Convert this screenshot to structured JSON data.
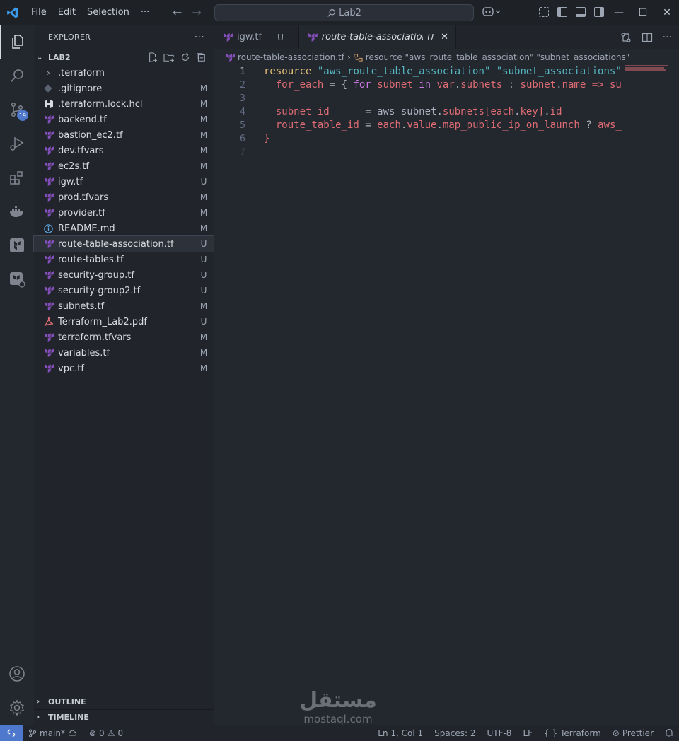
{
  "menu": {
    "items": [
      "File",
      "Edit",
      "Selection",
      "···"
    ]
  },
  "search": {
    "label": "Lab2"
  },
  "window": {
    "minimize": "—",
    "maximize": "☐",
    "close": "✕"
  },
  "activity": {
    "scm_badge": "19"
  },
  "explorer": {
    "title": "EXPLORER",
    "more": "···",
    "root": "LAB2",
    "files": [
      {
        "name": ".terraform",
        "icon": "folder-chevron",
        "status": ""
      },
      {
        "name": ".gitignore",
        "icon": "git-file-icon",
        "status": "M"
      },
      {
        "name": ".terraform.lock.hcl",
        "icon": "hcl-icon",
        "status": "M"
      },
      {
        "name": "backend.tf",
        "icon": "terraform-icon",
        "status": "M"
      },
      {
        "name": "bastion_ec2.tf",
        "icon": "terraform-icon",
        "status": "M"
      },
      {
        "name": "dev.tfvars",
        "icon": "terraform-icon",
        "status": "M"
      },
      {
        "name": "ec2s.tf",
        "icon": "terraform-icon",
        "status": "M"
      },
      {
        "name": "igw.tf",
        "icon": "terraform-icon",
        "status": "U"
      },
      {
        "name": "prod.tfvars",
        "icon": "terraform-icon",
        "status": "M"
      },
      {
        "name": "provider.tf",
        "icon": "terraform-icon",
        "status": "M"
      },
      {
        "name": "README.md",
        "icon": "info-icon",
        "status": "M"
      },
      {
        "name": "route-table-association.tf",
        "icon": "terraform-icon",
        "status": "U"
      },
      {
        "name": "route-tables.tf",
        "icon": "terraform-icon",
        "status": "U"
      },
      {
        "name": "security-group.tf",
        "icon": "terraform-icon",
        "status": "U"
      },
      {
        "name": "security-group2.tf",
        "icon": "terraform-icon",
        "status": "U"
      },
      {
        "name": "subnets.tf",
        "icon": "terraform-icon",
        "status": "M"
      },
      {
        "name": "Terraform_Lab2.pdf",
        "icon": "pdf-icon",
        "status": "U"
      },
      {
        "name": "terraform.tfvars",
        "icon": "terraform-icon",
        "status": "M"
      },
      {
        "name": "variables.tf",
        "icon": "terraform-icon",
        "status": "M"
      },
      {
        "name": "vpc.tf",
        "icon": "terraform-icon",
        "status": "M"
      }
    ],
    "outline": "OUTLINE",
    "timeline": "TIMELINE"
  },
  "tabs": [
    {
      "label": "igw.tf",
      "status": "U"
    },
    {
      "label": "route-table-association.tf",
      "status": "U"
    }
  ],
  "breadcrumb": {
    "file": "route-table-association.tf",
    "symbol": "resource \"aws_route_table_association\" \"subnet_associations\""
  },
  "editor": {
    "line_numbers": [
      "1",
      "2",
      "3",
      "4",
      "5",
      "6",
      "7"
    ],
    "tokens": {
      "l1_kw": "resource",
      "l1_s1": "\"aws_route_table_association\"",
      "l1_s2": "\"subnet_associations\"",
      "l2_prop": "for_each",
      "l2_eq": " = { ",
      "l2_for": "for",
      "l2_subnet": "subnet",
      "l2_in": "in",
      "l2_var": "var",
      "l2_subnets": "subnets",
      "l2_colon": " : ",
      "l2_sn": "subnet",
      "l2_name": "name",
      "l2_arrow": " => ",
      "l2_su": "su",
      "l4_prop": "subnet_id",
      "l4_eq": "      = ",
      "l4_aws": "aws_subnet",
      "l4_subnets": "subnets",
      "l4_each": "[each",
      "l4_key": "key",
      "l4_id": "id",
      "l5_prop": "route_table_id",
      "l5_eq": " = ",
      "l5_each": "each",
      "l5_value": "value",
      "l5_map": "map_public_ip_on_launch",
      "l5_q": " ? ",
      "l5_aws": "aws_",
      "l6_close": "}"
    }
  },
  "watermark": {
    "arabic": "مستقل",
    "latin": "mostaql.com"
  },
  "status": {
    "branch": "main*",
    "errors": "0",
    "warnings": "0",
    "position": "Ln 1, Col 1",
    "spaces": "Spaces: 2",
    "encoding": "UTF-8",
    "eol": "LF",
    "language": "Terraform",
    "prettier": "Prettier"
  },
  "colors": {
    "accent": "#4d78cc",
    "terraform": "#844fba",
    "keyword": "#e5c07b",
    "string": "#56b6c2",
    "property": "#e06c75"
  }
}
